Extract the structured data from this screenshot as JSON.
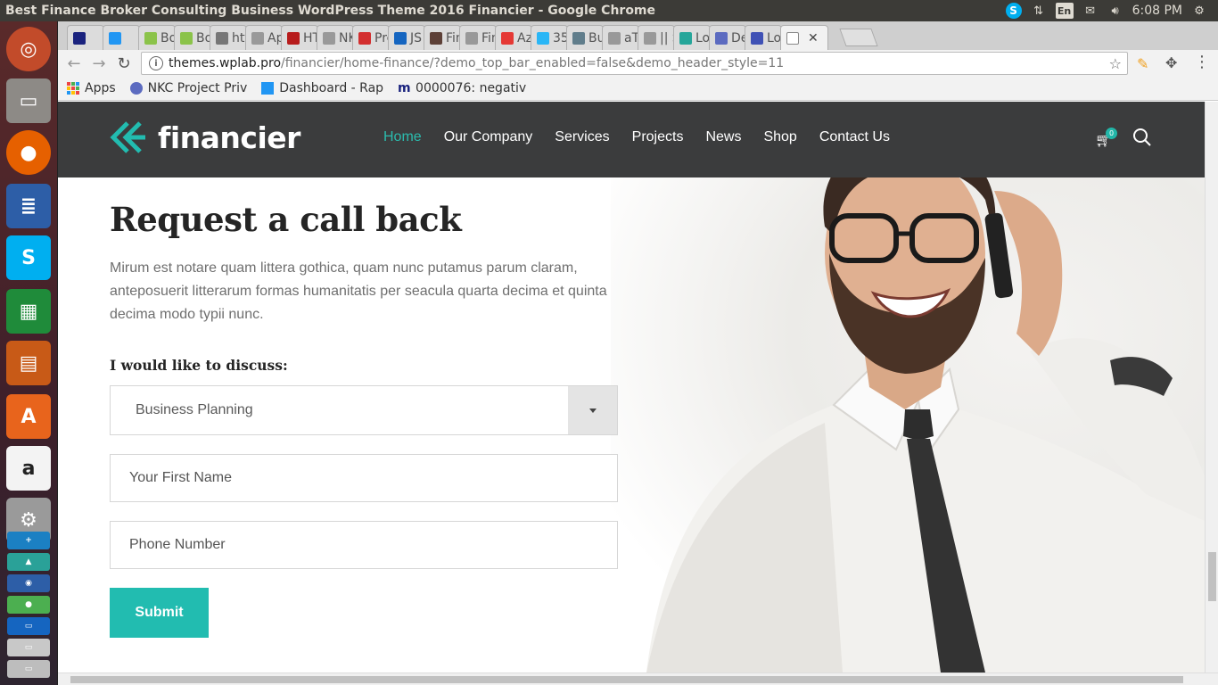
{
  "window": {
    "title": "Best Finance Broker Consulting Business WordPress Theme 2016 Financier - Google Chrome",
    "clock": "6:08 PM",
    "lang": "En"
  },
  "tabs": [
    {
      "label": "",
      "color": "#1a237e"
    },
    {
      "label": "",
      "color": "#2196f3"
    },
    {
      "label": "Bo",
      "color": "#8bc34a"
    },
    {
      "label": "Bo",
      "color": "#8bc34a"
    },
    {
      "label": "htt",
      "color": "#777777"
    },
    {
      "label": "Ap",
      "color": "#999999"
    },
    {
      "label": "HT",
      "color": "#b71c1c"
    },
    {
      "label": "NK",
      "color": "#999999"
    },
    {
      "label": "Pre",
      "color": "#d32f2f"
    },
    {
      "label": "JS",
      "color": "#1565c0"
    },
    {
      "label": "Fin",
      "color": "#5d4037"
    },
    {
      "label": "Fin",
      "color": "#999999"
    },
    {
      "label": "Az",
      "color": "#e53935"
    },
    {
      "label": "35",
      "color": "#29b6f6"
    },
    {
      "label": "Bu",
      "color": "#607d8b"
    },
    {
      "label": "aT",
      "color": "#999999"
    },
    {
      "label": "|| S",
      "color": "#999999"
    },
    {
      "label": "Lo",
      "color": "#26a69a"
    },
    {
      "label": "De",
      "color": "#5c6bc0"
    },
    {
      "label": "Lo",
      "color": "#3f51b5"
    }
  ],
  "address": {
    "host": "themes.wplab.pro",
    "path": "/financier/home-finance/?demo_top_bar_enabled=false&demo_header_style=11"
  },
  "bookmarks": [
    {
      "label": "Apps"
    },
    {
      "label": "NKC Project Priv"
    },
    {
      "label": "Dashboard - Rap"
    },
    {
      "label": "0000076: negativ"
    }
  ],
  "site": {
    "logo": "financier",
    "menu": [
      "Home",
      "Our Company",
      "Services",
      "Projects",
      "News",
      "Shop",
      "Contact Us"
    ],
    "cart_count": "0"
  },
  "form": {
    "title": "Request a call back",
    "lead": "Mirum est notare quam littera gothica, quam nunc putamus parum claram, anteposuerit litterarum formas humanitatis per seacula quarta decima et quinta decima modo typii nunc.",
    "discuss_label": "I would like to discuss:",
    "topic": "Business Planning",
    "first_name_placeholder": "Your First Name",
    "phone_placeholder": "Phone Number",
    "submit": "Submit"
  },
  "colors": {
    "accent": "#22bcb0",
    "header_bg": "#3b3c3d"
  }
}
